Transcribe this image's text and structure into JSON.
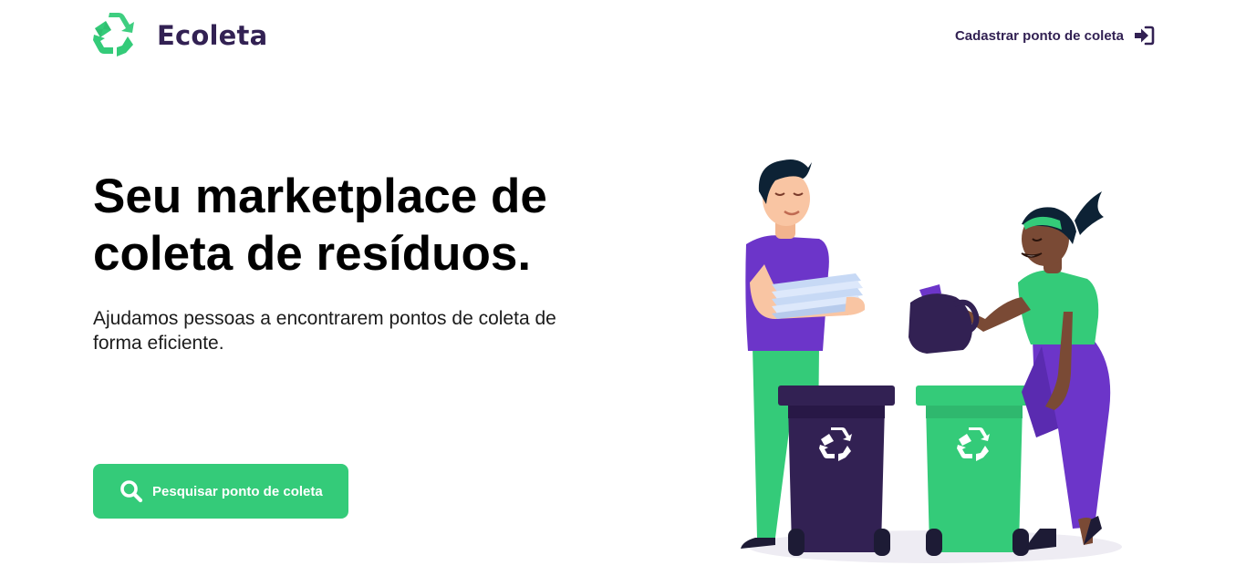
{
  "header": {
    "logo": {
      "icon": "recycle-icon",
      "text": "Ecoleta"
    },
    "signup_link": {
      "label": "Cadastrar ponto de coleta",
      "icon": "sign-in-icon"
    }
  },
  "hero": {
    "title": "Seu marketplace de coleta de resíduos.",
    "description": "Ajudamos pessoas a encontrarem pontos de coleta de forma eficiente.",
    "button": {
      "label": "Pesquisar ponto de coleta",
      "icon": "search-icon"
    }
  },
  "illustration": {
    "subject": "people-recycling-illustration"
  },
  "colors": {
    "primary": "#34cb79",
    "title": "#322153",
    "background": "#ffffff",
    "bin_dark": "#322153",
    "shirt_purple": "#6c35c9"
  }
}
